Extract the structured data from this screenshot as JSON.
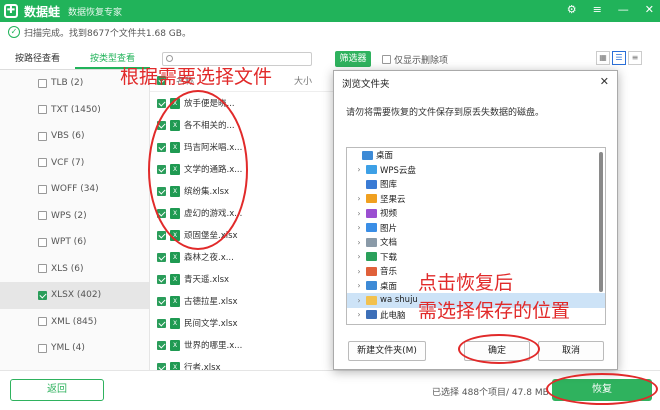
{
  "app": {
    "title": "数据蛙",
    "subtitle": "数据恢复专家",
    "logo": "✚",
    "controls": [
      "⚙",
      "≡",
      "—",
      "✕"
    ]
  },
  "status": {
    "icon": "✓",
    "text": "扫描完成。找到8677个文件共1.68 GB。"
  },
  "tabs": [
    {
      "label": "按路径查看",
      "active": false
    },
    {
      "label": "按类型查看",
      "active": true
    }
  ],
  "toolbar": {
    "search_placeholder": "",
    "filter_label": "筛选器",
    "only_deleted_label": "仅显示删除项",
    "views": [
      "▦",
      "☰",
      "≡"
    ]
  },
  "sidebar": {
    "items": [
      {
        "label": "TLB (2)",
        "checked": false
      },
      {
        "label": "TXT (1450)",
        "checked": false
      },
      {
        "label": "VBS (6)",
        "checked": false
      },
      {
        "label": "VCF (7)",
        "checked": false
      },
      {
        "label": "WOFF (34)",
        "checked": false
      },
      {
        "label": "WPS (2)",
        "checked": false
      },
      {
        "label": "WPT (6)",
        "checked": false
      },
      {
        "label": "XLS (6)",
        "checked": false
      },
      {
        "label": "XLSX (402)",
        "checked": true,
        "active": true
      },
      {
        "label": "XML (845)",
        "checked": false
      },
      {
        "label": "YML (4)",
        "checked": false
      }
    ]
  },
  "filelist": {
    "header_name": "名称",
    "header_size": "大小",
    "rows": [
      "放手便是晓...",
      "各不相关的...",
      "玛吉阿米唱.x...",
      "文学的通路.x...",
      "缤纷集.xlsx",
      "虚幻的游戏.x...",
      "顽固堡垒.xlsx",
      "森林之夜.x...",
      "青天遥.xlsx",
      "古德拉星.xlsx",
      "民间文学.xlsx",
      "世界的哪里.x...",
      "行者.xlsx"
    ]
  },
  "bottom": {
    "back_label": "返回",
    "selected_info": "已选择 488个项目/ 47.8 MB",
    "recover_label": "恢复"
  },
  "dialog": {
    "title": "浏览文件夹",
    "close": "✕",
    "message": "请勿将需要恢复的文件保存到原丢失数据的磁盘。",
    "tree": [
      {
        "label": "桌面",
        "level": 0,
        "icon_color": "#3d8ad6",
        "chevron": ""
      },
      {
        "label": "WPS云盘",
        "level": 1,
        "icon_color": "#3da0e6",
        "chevron": "›"
      },
      {
        "label": "图库",
        "level": 1,
        "icon_color": "#3a7bd5",
        "chevron": ""
      },
      {
        "label": "坚果云",
        "level": 1,
        "icon_color": "#f0a020",
        "chevron": "›"
      },
      {
        "label": "视频",
        "level": 1,
        "icon_color": "#9b4fd1",
        "chevron": "›"
      },
      {
        "label": "图片",
        "level": 1,
        "icon_color": "#3a8ee6",
        "chevron": "›"
      },
      {
        "label": "文档",
        "level": 1,
        "icon_color": "#8a9aa8",
        "chevron": "›"
      },
      {
        "label": "下载",
        "level": 1,
        "icon_color": "#2aa05a",
        "chevron": "›"
      },
      {
        "label": "音乐",
        "level": 1,
        "icon_color": "#e0603a",
        "chevron": "›"
      },
      {
        "label": "桌面",
        "level": 1,
        "icon_color": "#3d8ad6",
        "chevron": "›"
      },
      {
        "label": "wa shuju",
        "level": 1,
        "icon_color": "#f2c14e",
        "chevron": "›",
        "selected": true
      },
      {
        "label": "此电脑",
        "level": 1,
        "icon_color": "#3d6fb8",
        "chevron": "›"
      }
    ],
    "new_folder_label": "新建文件夹(M)",
    "ok_label": "确定",
    "cancel_label": "取消"
  },
  "annotations": {
    "top": "根据需要选择文件",
    "bottom_line1": "点击恢复后",
    "bottom_line2": "需选择保存的位置",
    "color": "#e12a2a"
  }
}
